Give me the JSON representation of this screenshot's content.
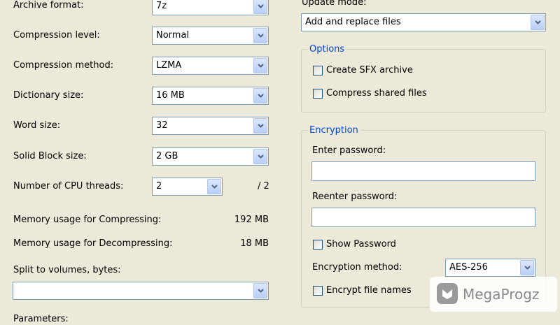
{
  "left": {
    "archive_format": {
      "label": "Archive format:",
      "value": "7z"
    },
    "compression_level": {
      "label": "Compression level:",
      "value": "Normal"
    },
    "compression_method": {
      "label": "Compression method:",
      "value": "LZMA"
    },
    "dictionary_size": {
      "label": "Dictionary size:",
      "value": "16 MB"
    },
    "word_size": {
      "label": "Word size:",
      "value": "32"
    },
    "solid_block_size": {
      "label": "Solid Block size:",
      "value": "2 GB"
    },
    "cpu_threads": {
      "label": "Number of CPU threads:",
      "value": "2",
      "max": "/ 2"
    },
    "memory_compress": {
      "label": "Memory usage for Compressing:",
      "value": "192 MB"
    },
    "memory_decompress": {
      "label": "Memory usage for Decompressing:",
      "value": "18 MB"
    },
    "split_volumes": {
      "label": "Split to volumes, bytes:",
      "value": ""
    },
    "parameters": {
      "label": "Parameters:"
    }
  },
  "right": {
    "update_mode": {
      "label": "Update mode:",
      "value": "Add and replace files"
    },
    "options": {
      "title": "Options",
      "create_sfx": {
        "label": "Create SFX archive",
        "checked": false
      },
      "compress_shared": {
        "label": "Compress shared files",
        "checked": false
      }
    },
    "encryption": {
      "title": "Encryption",
      "enter_password_label": "Enter password:",
      "password_value": "",
      "reenter_password_label": "Reenter password:",
      "reenter_value": "",
      "show_password": {
        "label": "Show Password",
        "checked": false
      },
      "method_label": "Encryption method:",
      "method_value": "AES-256",
      "encrypt_names": {
        "label": "Encrypt file names",
        "checked": false
      }
    }
  },
  "watermark": {
    "text": "MegaProgz"
  },
  "colors": {
    "background": "#ECE9D8",
    "group_title": "#0046D5",
    "field_border": "#7F9DB9"
  },
  "icons": {
    "dropdown": "chevron-down-icon",
    "checkbox": "checkbox-icon",
    "watermark": "megaprogz-logo-icon"
  }
}
